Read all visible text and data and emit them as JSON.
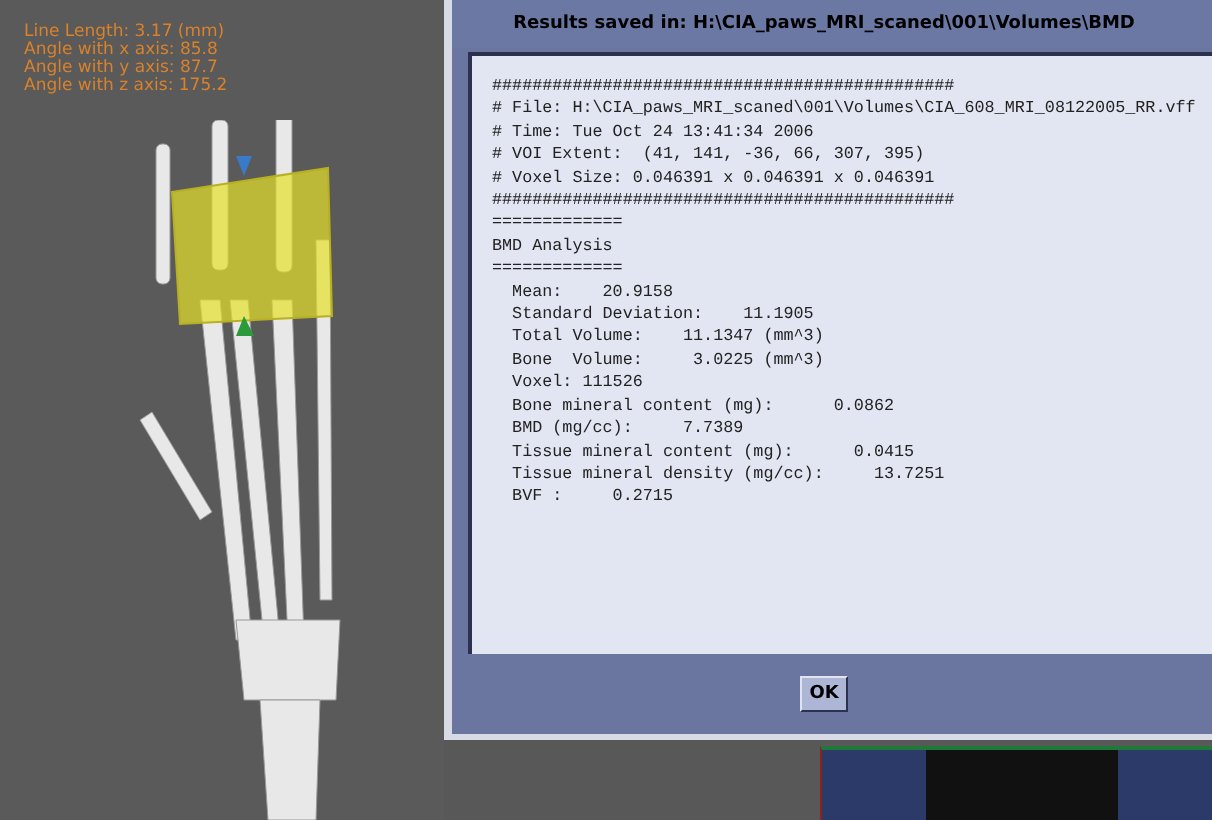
{
  "viewport": {
    "overlay_lines": [
      "Line Length: 3.17 (mm)",
      "Angle with x axis: 85.8",
      "Angle with y axis: 87.7",
      "Angle with z axis: 175.2"
    ]
  },
  "dialog": {
    "title": "Results saved in: H:\\CIA_paws_MRI_scaned\\001\\Volumes\\BMD",
    "lines": [
      "##############################################",
      "# File: H:\\CIA_paws_MRI_scaned\\001\\Volumes\\CIA_608_MRI_08122005_RR.vff",
      "# Time: Tue Oct 24 13:41:34 2006",
      "# VOI Extent:  (41, 141, -36, 66, 307, 395)",
      "# Voxel Size: 0.046391 x 0.046391 x 0.046391",
      "##############################################",
      "=============",
      "BMD Analysis",
      "=============",
      "  Mean:    20.9158",
      "  Standard Deviation:    11.1905",
      "  Total Volume:    11.1347 (mm^3)",
      "  Bone  Volume:     3.0225 (mm^3)",
      "  Voxel: 111526",
      "  Bone mineral content (mg):      0.0862",
      "  BMD (mg/cc):     7.7389",
      "  Tissue mineral content (mg):      0.0415",
      "  Tissue mineral density (mg/cc):     13.7251",
      "  BVF :     0.2715"
    ],
    "ok_button": "OK"
  }
}
